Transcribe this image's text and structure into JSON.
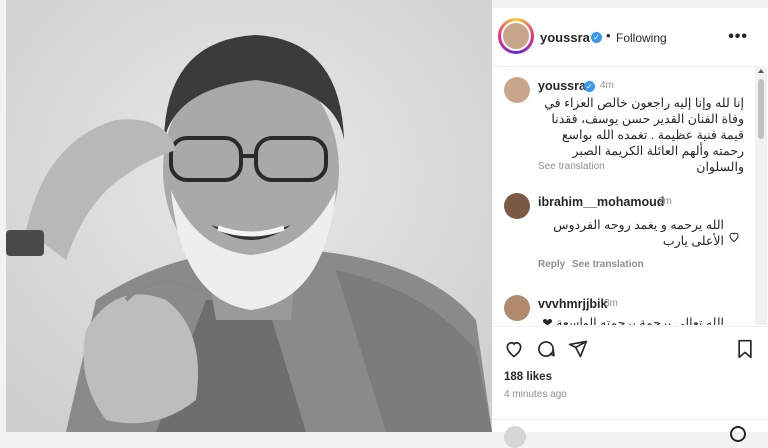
{
  "post": {
    "author": "youssra",
    "follow_status": "Following",
    "more_label": "•••",
    "likes": "188 likes",
    "time_ago": "4 minutes ago"
  },
  "caption": {
    "author": "youssra",
    "time": "4m",
    "text": "إنا لله وإنا إليه راجعون خالص العزاء في وفاة الفنان القدير حسن يوسف، فقدنا قيمة فنية عظيمة . تغمده الله بواسع رحمته وألهم العائلة الكريمة الصبر والسلوان",
    "translation_label": "See translation"
  },
  "comments": [
    {
      "author": "ibrahim__mohamoud",
      "time": "2m",
      "text": "الله يرحمه و يغمد روحه الفردوس الأعلى يارب",
      "reply_label": "Reply",
      "translation_label": "See translation"
    },
    {
      "author": "vvvhmrjjbik",
      "time": "3m",
      "text": "الله تعالى برحمة برحمته الواسعة ❤"
    }
  ],
  "icons": [
    "verified-badge-icon",
    "more-options-icon",
    "heart-icon",
    "comment-icon",
    "share-icon",
    "bookmark-icon"
  ],
  "colors": {
    "verified": "#3897f0",
    "meta_text": "#8e8e8e",
    "heart_red": "#ed4956"
  }
}
